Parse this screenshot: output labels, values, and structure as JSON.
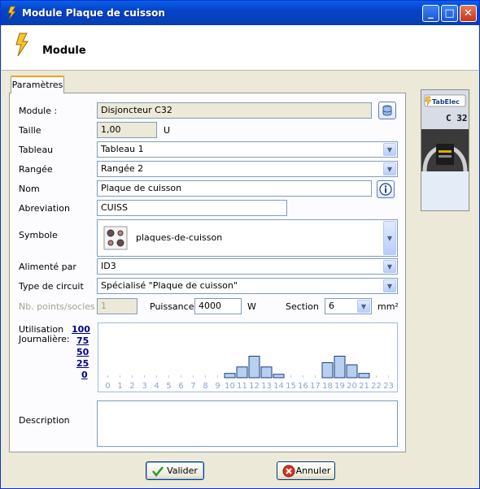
{
  "window": {
    "title": "Module Plaque de cuisson"
  },
  "header": {
    "title": "Module"
  },
  "tab": {
    "label": "Paramètres"
  },
  "form": {
    "module": {
      "label": "Module :",
      "value": "Disjoncteur C32"
    },
    "taille": {
      "label": "Taille",
      "value": "1,00",
      "unit": "U"
    },
    "tableau": {
      "label": "Tableau",
      "value": "Tableau 1"
    },
    "rangee": {
      "label": "Rangée",
      "value": "Rangée 2"
    },
    "nom": {
      "label": "Nom",
      "value": "Plaque de cuisson"
    },
    "abreviation": {
      "label": "Abreviation",
      "value": "CUISS"
    },
    "symbole": {
      "label": "Symbole",
      "value": "plaques-de-cuisson"
    },
    "alimente": {
      "label": "Alimenté par",
      "value": "ID3"
    },
    "type": {
      "label": "Type de circuit",
      "value": "Spécialisé \"Plaque de cuisson\""
    },
    "nbpoints": {
      "label": "Nb. points/socles",
      "value": "1"
    },
    "puissance": {
      "label": "Puissance",
      "value": "4000",
      "unit": "W"
    },
    "section": {
      "label": "Section",
      "value": "6",
      "unit": "mm²"
    },
    "utilisation": {
      "label1": "Utilisation",
      "label2": "Journalière:"
    },
    "description": {
      "label": "Description",
      "value": ""
    }
  },
  "usage_scale": [
    "100",
    "75",
    "50",
    "25",
    "0"
  ],
  "chart_data": {
    "type": "bar",
    "x": [
      0,
      1,
      2,
      3,
      4,
      5,
      6,
      7,
      8,
      9,
      10,
      11,
      12,
      13,
      14,
      15,
      16,
      17,
      18,
      19,
      20,
      21,
      22,
      23
    ],
    "values": [
      0,
      0,
      0,
      0,
      0,
      0,
      0,
      0,
      0,
      0,
      10,
      25,
      50,
      25,
      8,
      0,
      0,
      0,
      35,
      50,
      30,
      10,
      0,
      0
    ],
    "ylim": [
      0,
      100
    ]
  },
  "preview": {
    "brand": "TabElec",
    "label": "C 32"
  },
  "buttons": {
    "ok": "Valider",
    "cancel": "Annuler"
  },
  "colors": {
    "bar": "#b8cff0",
    "bar_border": "#1c3e7a",
    "title": "#0542c8",
    "accent": "#f6a01e"
  }
}
